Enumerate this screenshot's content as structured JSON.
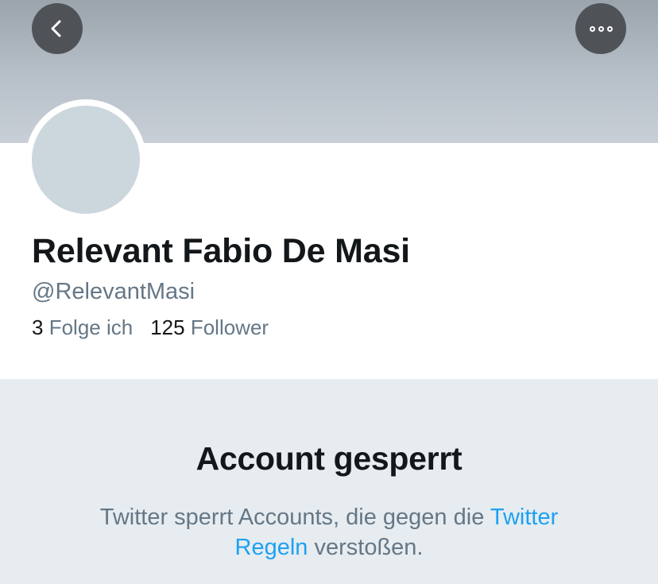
{
  "header": {
    "back_icon": "chevron-left-icon",
    "more_icon": "more-horizontal-icon"
  },
  "profile": {
    "display_name": "Relevant Fabio De Masi",
    "handle": "@RelevantMasi",
    "following_count": "3",
    "following_label": "Folge ich",
    "followers_count": "125",
    "followers_label": "Follower"
  },
  "notice": {
    "title": "Account gesperrt",
    "text_before": "Twitter sperrt Accounts, die gegen die ",
    "link_text": "Twitter Regeln",
    "text_after": " verstoßen."
  },
  "colors": {
    "link": "#1da1f2",
    "secondary_text": "#657786",
    "primary_text": "#14171a",
    "notice_background": "#e6ecf0"
  }
}
